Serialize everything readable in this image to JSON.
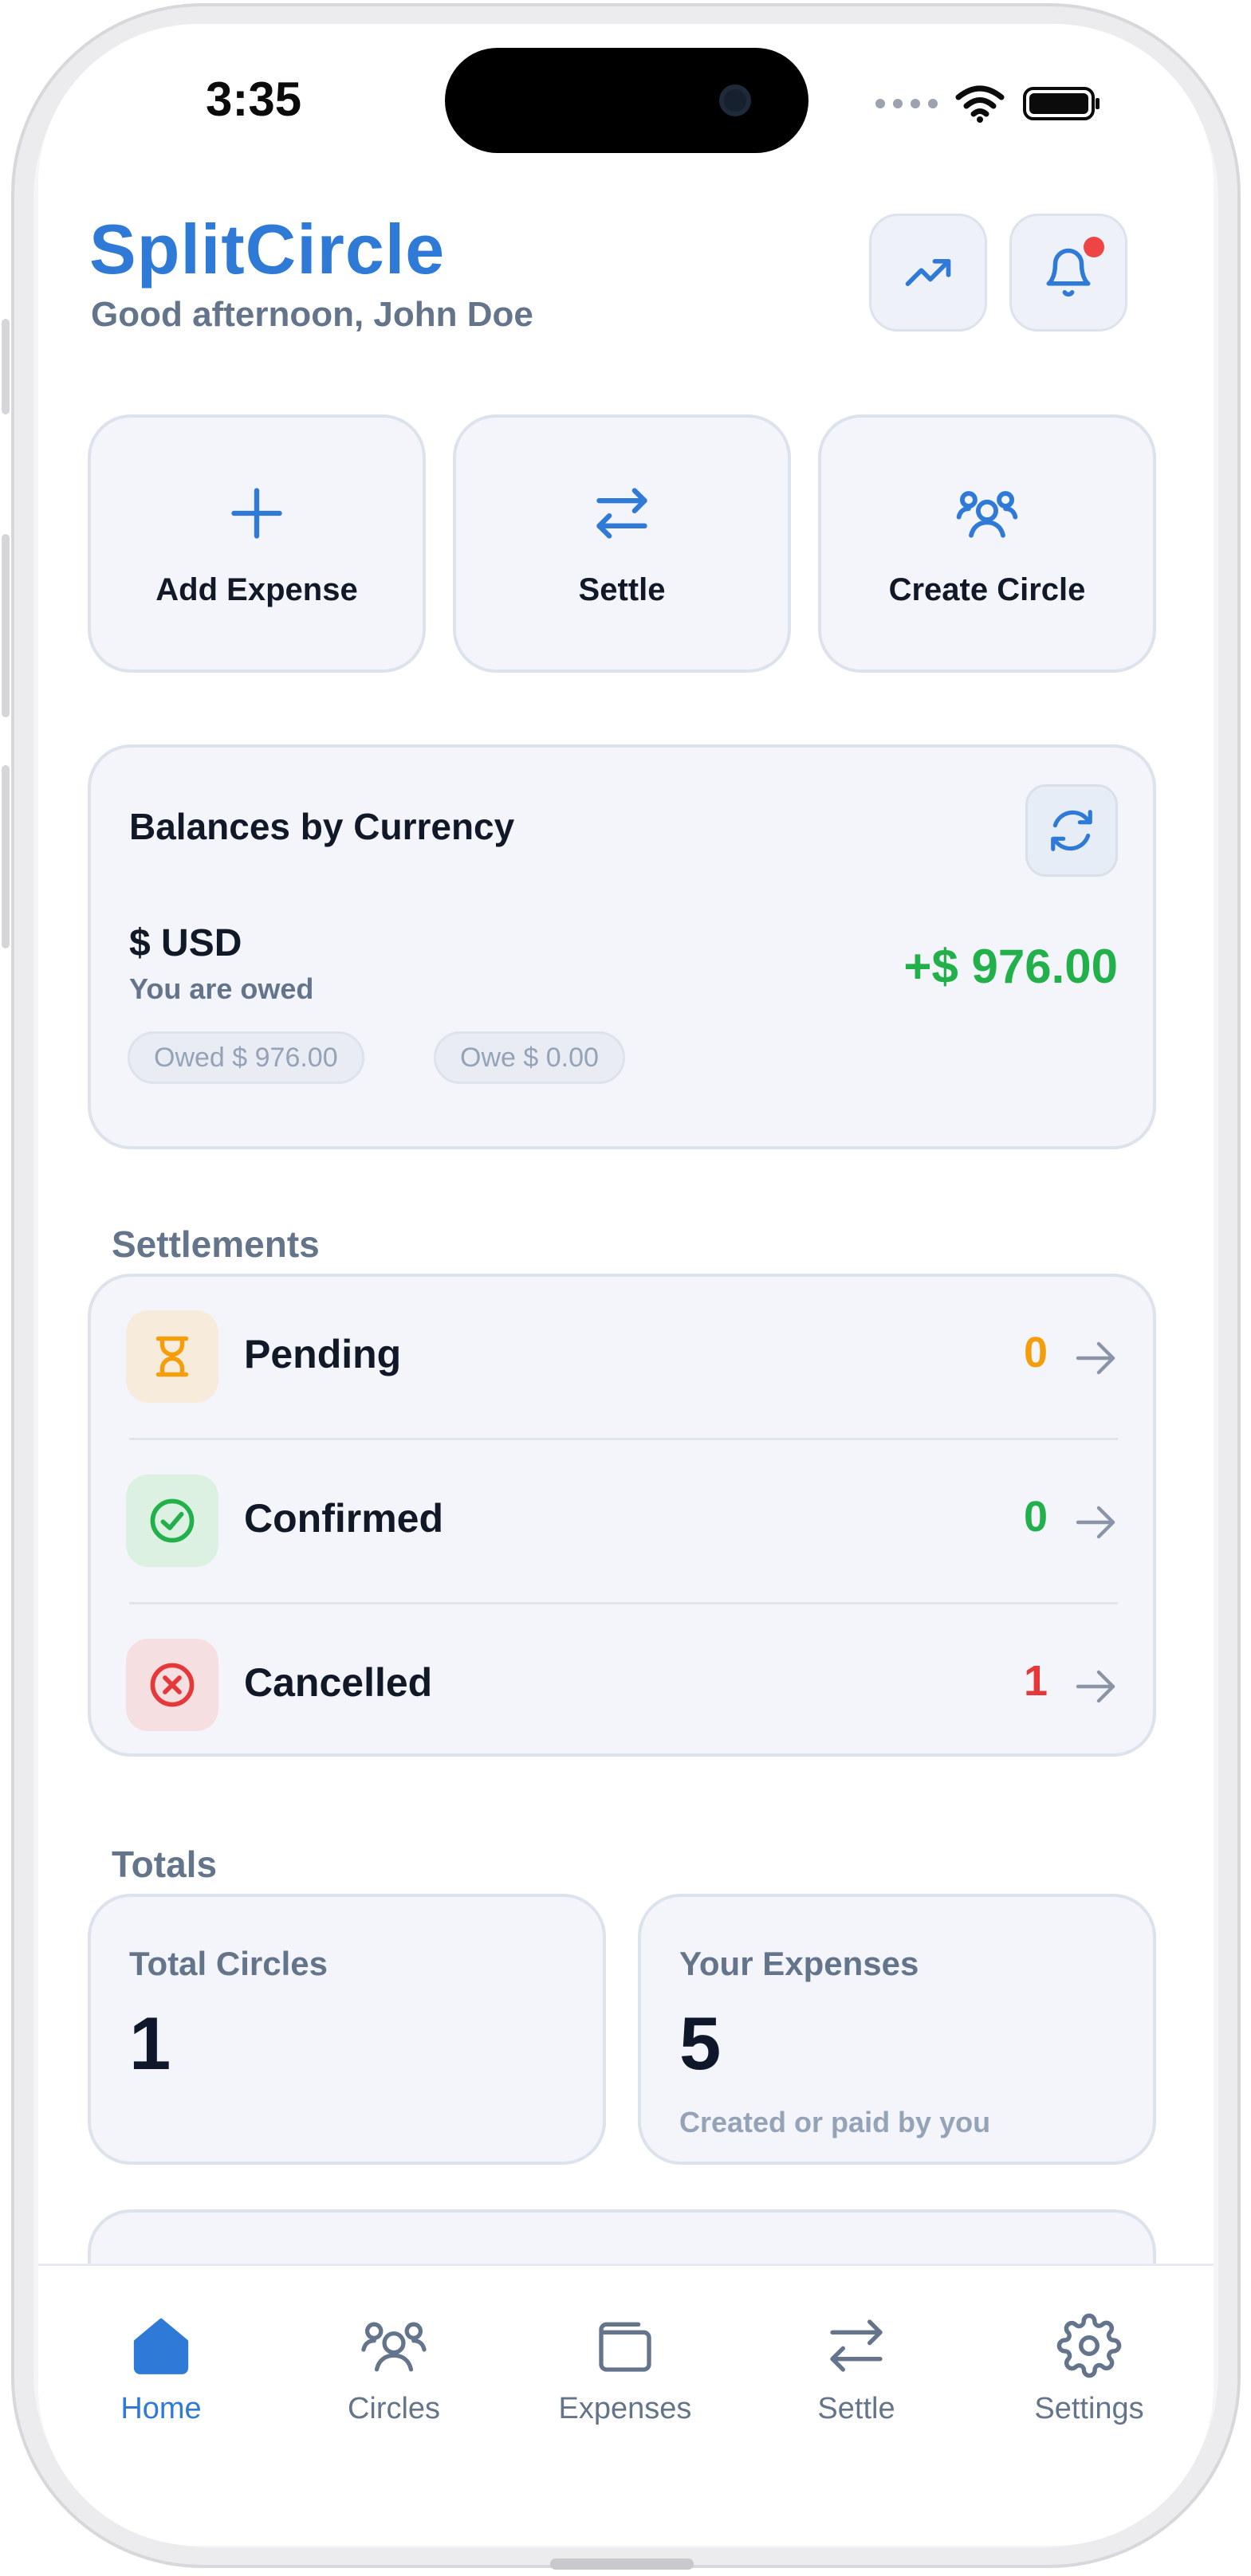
{
  "status_bar": {
    "time": "3:35"
  },
  "header": {
    "app_title": "SplitCircle",
    "greeting": "Good afternoon, John Doe",
    "has_notification": true
  },
  "quick_actions": [
    {
      "label": "Add Expense",
      "icon": "plus-icon"
    },
    {
      "label": "Settle",
      "icon": "swap-arrows-icon"
    },
    {
      "label": "Create Circle",
      "icon": "group-icon"
    }
  ],
  "balances": {
    "title": "Balances by Currency",
    "currency": {
      "name": "$ USD",
      "status": "You are owed",
      "net": "+$ 976.00",
      "owed_pill": "Owed $ 976.00",
      "owe_pill": "Owe $ 0.00"
    }
  },
  "settlements": {
    "heading": "Settlements",
    "items": [
      {
        "label": "Pending",
        "count": "0",
        "color": "#f59e0b",
        "icon": "hourglass-icon"
      },
      {
        "label": "Confirmed",
        "count": "0",
        "color": "#22b04b",
        "icon": "check-circle-icon"
      },
      {
        "label": "Cancelled",
        "count": "1",
        "color": "#e5383b",
        "icon": "x-circle-icon"
      }
    ]
  },
  "totals": {
    "heading": "Totals",
    "circles": {
      "label": "Total Circles",
      "value": "1"
    },
    "expenses": {
      "label": "Your Expenses",
      "value": "5",
      "sub": "Created or paid by you"
    }
  },
  "tabbar": {
    "active": "Home",
    "items": [
      {
        "label": "Home",
        "icon": "home-icon"
      },
      {
        "label": "Circles",
        "icon": "group-icon"
      },
      {
        "label": "Expenses",
        "icon": "wallet-icon"
      },
      {
        "label": "Settle",
        "icon": "swap-arrows-icon"
      },
      {
        "label": "Settings",
        "icon": "gear-icon"
      }
    ]
  },
  "colors": {
    "brand": "#2f7ad6",
    "positive": "#22b04b",
    "negative": "#e5383b",
    "warning": "#f59e0b"
  }
}
